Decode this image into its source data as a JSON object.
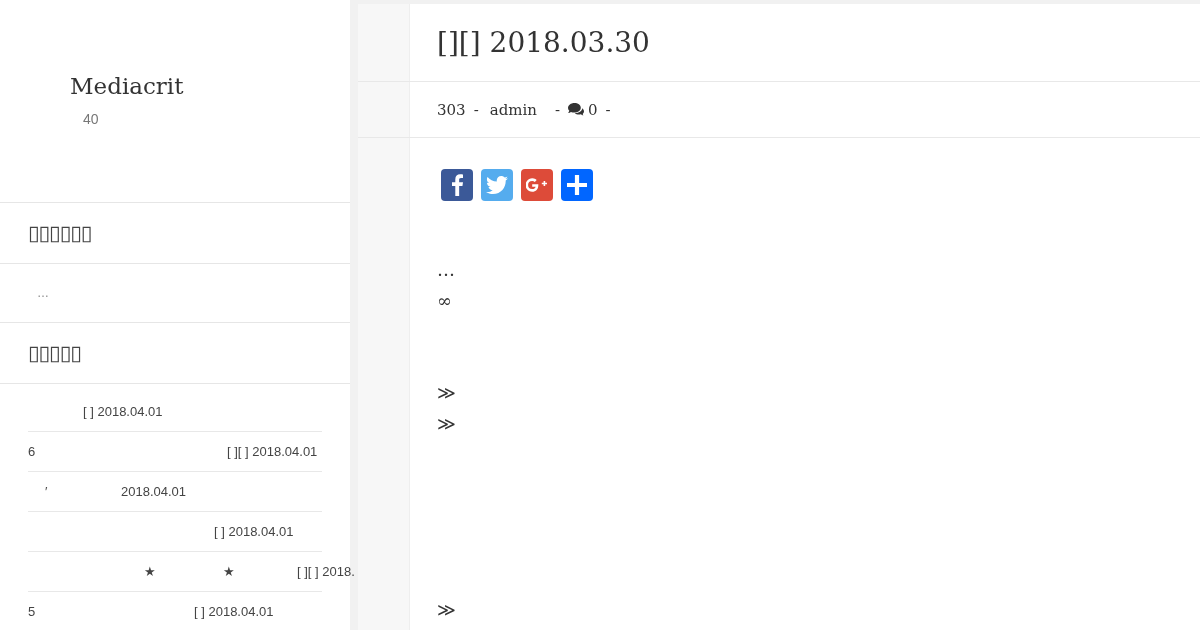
{
  "sidebar": {
    "site_title": "Mediacrit",
    "tagline": "40",
    "widgets": [
      {
        "kind": "text",
        "title": "▯▯▯▯▯▯",
        "text": "…"
      },
      {
        "kind": "list",
        "title": "▯▯▯▯▯",
        "items": [
          {
            "parts": [
              "[ ] 2018.04.01"
            ]
          },
          {
            "parts": [
              "6",
              "[ ][ ] 2018.04.01"
            ]
          },
          {
            "parts": [
              "′",
              "2018.04.01"
            ]
          },
          {
            "parts": [
              "[ ] 2018.04.01"
            ]
          },
          {
            "parts": [
              "★",
              "★",
              "[ ][ ] 2018."
            ]
          },
          {
            "parts": [
              "5",
              "[ ] 2018.04.01"
            ]
          }
        ]
      }
    ]
  },
  "post": {
    "title": "[][] 2018.03.30",
    "meta": [
      {
        "kind": "views",
        "text": "303"
      },
      {
        "kind": "separator",
        "text": "-"
      },
      {
        "kind": "author",
        "text": "admin"
      },
      {
        "kind": "separator",
        "text": "-"
      },
      {
        "kind": "comments",
        "text": "0"
      },
      {
        "kind": "separator",
        "text": "-"
      }
    ],
    "share_buttons": [
      {
        "kind": "facebook"
      },
      {
        "kind": "twitter"
      },
      {
        "kind": "google_plus"
      },
      {
        "kind": "share"
      }
    ],
    "content": [
      {
        "lines": [
          "…",
          "∞"
        ]
      },
      {
        "lines": [
          "≫",
          "≫"
        ]
      },
      {
        "lines": [
          "≫"
        ]
      }
    ]
  }
}
